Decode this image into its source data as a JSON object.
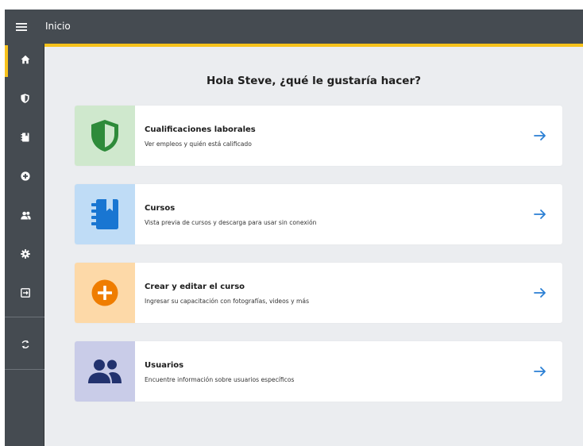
{
  "app": {
    "title": "Inicio"
  },
  "colors": {
    "topbar": "#454b51",
    "accent": "#f7c21b",
    "link_arrow": "#2a7fd4",
    "shield_bg": "#cfe8cd",
    "shield_fg": "#2e8b3a",
    "courses_bg": "#bfdcf6",
    "courses_fg": "#1976d2",
    "create_bg": "#fdd9a8",
    "create_fg": "#ef7d00",
    "users_bg": "#c9cce8",
    "users_fg": "#22326e"
  },
  "sidebar": {
    "items": [
      {
        "name": "home",
        "icon": "home-icon",
        "active": true
      },
      {
        "name": "qualifications",
        "icon": "shield-icon"
      },
      {
        "name": "courses",
        "icon": "notebook-icon"
      },
      {
        "name": "create-course",
        "icon": "plus-circle-icon"
      },
      {
        "name": "users",
        "icon": "users-icon"
      },
      {
        "name": "settings",
        "icon": "gear-icon"
      },
      {
        "name": "logout",
        "icon": "exit-icon"
      },
      {
        "name": "sync",
        "icon": "sync-icon"
      }
    ]
  },
  "main": {
    "greeting": "Hola Steve, ¿qué le gustaría hacer?",
    "cards": [
      {
        "title": "Cualificaciones laborales",
        "description": "Ver empleos y quién está calificado",
        "icon": "shield-icon"
      },
      {
        "title": "Cursos",
        "description": "Vista previa de cursos y descarga para usar sin conexión",
        "icon": "notebook-icon"
      },
      {
        "title": "Crear y editar el curso",
        "description": "Ingresar su capacitación con fotografías, videos y más",
        "icon": "plus-circle-icon"
      },
      {
        "title": "Usuarios",
        "description": "Encuentre información sobre usuarios específicos",
        "icon": "users-icon"
      }
    ]
  }
}
